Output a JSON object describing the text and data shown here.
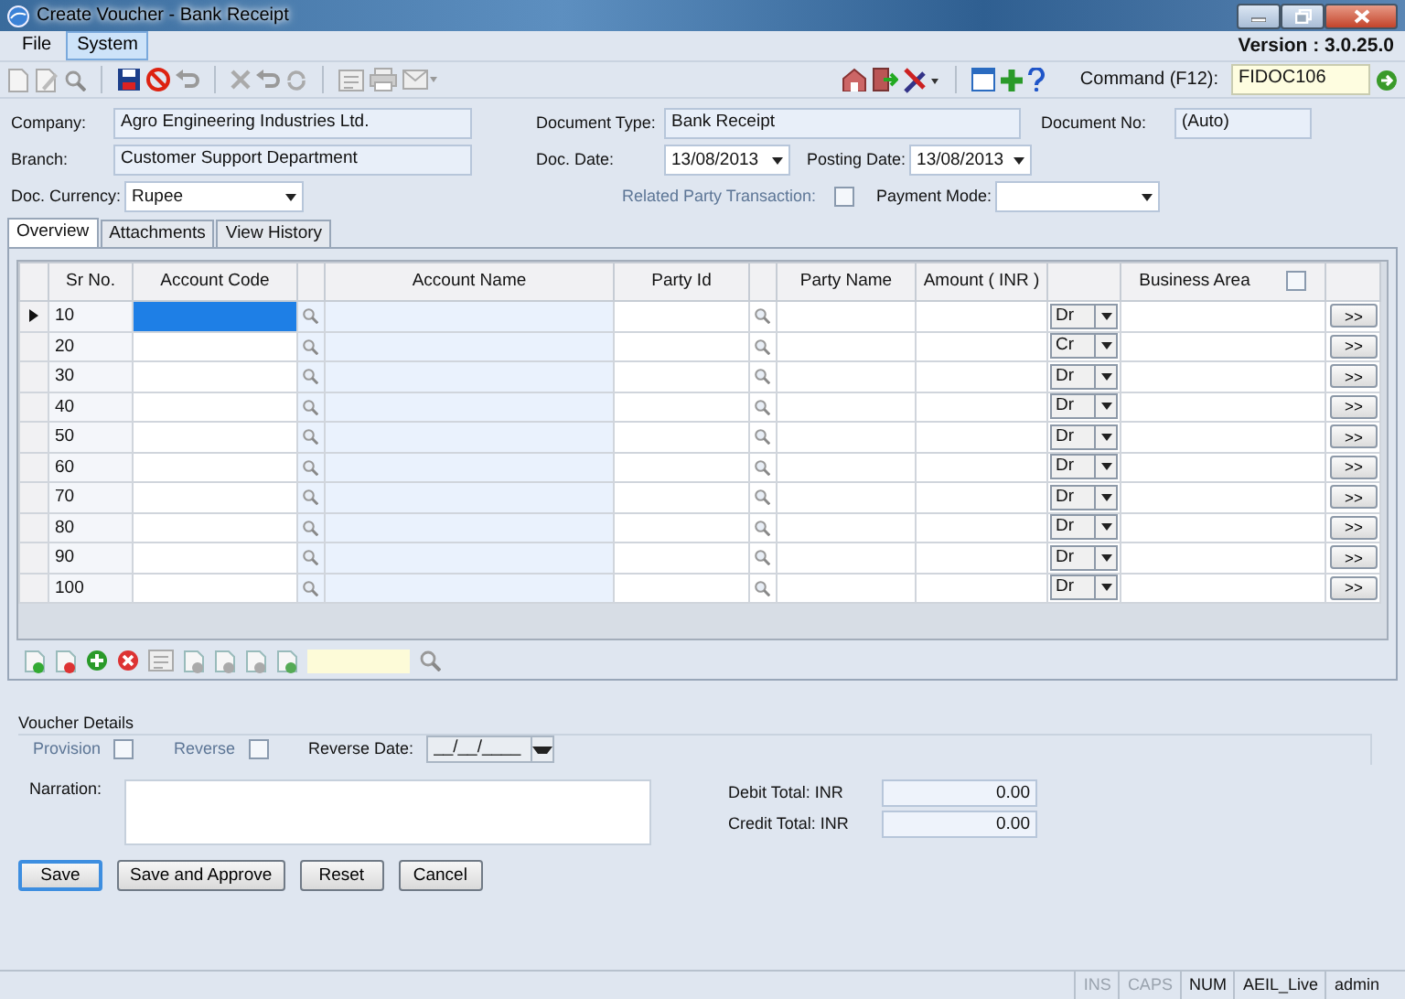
{
  "window": {
    "title": "Create Voucher - Bank Receipt"
  },
  "menu": [
    {
      "label": "File",
      "selected": false
    },
    {
      "label": "System",
      "selected": true
    }
  ],
  "version": "Version : 3.0.25.0",
  "command": {
    "label": "Command (F12):",
    "value": "FIDOC106"
  },
  "header": {
    "company": {
      "label": "Company:",
      "value": "Agro Engineering Industries Ltd."
    },
    "branch": {
      "label": "Branch:",
      "value": "Customer Support Department"
    },
    "doc_currency": {
      "label": "Doc. Currency:",
      "value": "Rupee"
    },
    "document_type": {
      "label": "Document Type:",
      "value": "Bank Receipt"
    },
    "doc_date": {
      "label": "Doc. Date:",
      "value": "13/08/2013"
    },
    "posting_date": {
      "label": "Posting Date:",
      "value": "13/08/2013"
    },
    "related_party": {
      "label": "Related Party Transaction:",
      "checked": false
    },
    "document_no": {
      "label": "Document No:",
      "value": "(Auto)"
    },
    "payment_mode": {
      "label": "Payment Mode:"
    }
  },
  "tabs": [
    {
      "label": "Overview",
      "selected": true
    },
    {
      "label": "Attachments",
      "selected": false
    },
    {
      "label": "View History",
      "selected": false
    }
  ],
  "grid": {
    "columns": [
      "Sr No.",
      "Account Code",
      "Account Name",
      "Party Id",
      "Party Name",
      "Amount ( INR )",
      "Business Area"
    ],
    "business_area_checked": false,
    "rows": [
      {
        "sr": "10",
        "side": "Dr",
        "selected": true,
        "button": ">>"
      },
      {
        "sr": "20",
        "side": "Cr",
        "selected": false,
        "button": ">>"
      },
      {
        "sr": "30",
        "side": "Dr",
        "selected": false,
        "button": ">>"
      },
      {
        "sr": "40",
        "side": "Dr",
        "selected": false,
        "button": ">>"
      },
      {
        "sr": "50",
        "side": "Dr",
        "selected": false,
        "button": ">>"
      },
      {
        "sr": "60",
        "side": "Dr",
        "selected": false,
        "button": ">>"
      },
      {
        "sr": "70",
        "side": "Dr",
        "selected": false,
        "button": ">>"
      },
      {
        "sr": "80",
        "side": "Dr",
        "selected": false,
        "button": ">>"
      },
      {
        "sr": "90",
        "side": "Dr",
        "selected": false,
        "button": ">>"
      },
      {
        "sr": "100",
        "side": "Dr",
        "selected": false,
        "button": ">>"
      }
    ]
  },
  "voucher_details": {
    "title": "Voucher Details",
    "provision": {
      "label": "Provision",
      "checked": false
    },
    "reverse": {
      "label": "Reverse",
      "checked": false
    },
    "reverse_date": {
      "label": "Reverse Date:",
      "value": "__/__/____"
    }
  },
  "narration": {
    "label": "Narration:"
  },
  "totals": [
    {
      "label": "Debit Total: INR",
      "value": "0.00"
    },
    {
      "label": "Credit Total: INR",
      "value": "0.00"
    }
  ],
  "buttons": [
    {
      "label": "Save",
      "default": true
    },
    {
      "label": "Save and Approve",
      "default": false
    },
    {
      "label": "Reset",
      "default": false
    },
    {
      "label": "Cancel",
      "default": false
    }
  ],
  "status_bar": [
    {
      "label": "INS",
      "enabled": false
    },
    {
      "label": "CAPS",
      "enabled": false
    },
    {
      "label": "NUM",
      "enabled": true
    },
    {
      "label": "AEIL_Live",
      "enabled": true
    },
    {
      "label": "admin",
      "enabled": true
    }
  ]
}
